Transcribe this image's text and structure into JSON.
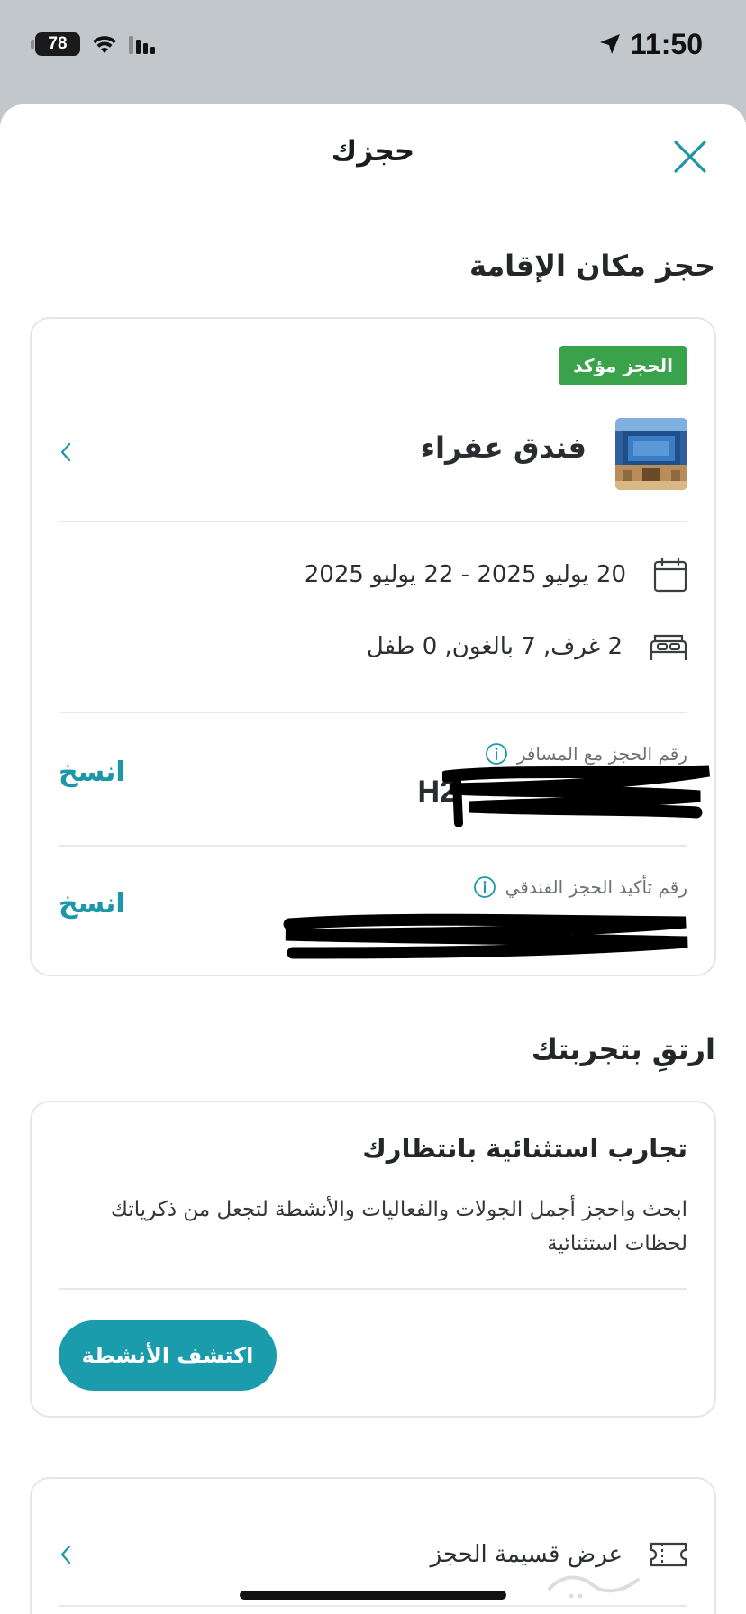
{
  "status_bar": {
    "battery_level": "78",
    "time": "11:50",
    "icons": [
      "battery-icon",
      "wifi-icon",
      "signal-icon",
      "location-arrow-icon"
    ]
  },
  "header": {
    "title": "حجزك",
    "close_icon": "close-icon"
  },
  "accommodation": {
    "section_title": "حجز مكان الإقامة",
    "status_badge": "الحجز مؤكد",
    "status_color": "#3aa24b",
    "hotel_name": "فندق عفراء",
    "dates": "20 يوليو 2025 - 22 يوليو 2025",
    "occupancy": "2 غرف, 7 بالغون, 0 طفل",
    "traveler_ref_label": "رقم الحجز مع المسافر",
    "traveler_ref_value": "H2",
    "hotel_conf_label": "رقم تأكيد الحجز الفندقي",
    "copy_label": "انسخ"
  },
  "enhance": {
    "section_title": "ارتقِ بتجربتك",
    "card_title": "تجارب استثنائية بانتظارك",
    "card_desc": "ابحث واحجز أجمل الجولات والفعاليات والأنشطة لتجعل من ذكرياتك لحظات استثنائية",
    "button_label": "اكتشف الأنشطة",
    "accent_color": "#1a9cad"
  },
  "voucher": {
    "label": "عرض قسيمة الحجز"
  }
}
